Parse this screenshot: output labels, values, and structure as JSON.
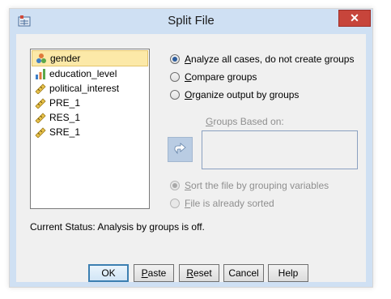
{
  "window": {
    "title": "Split File"
  },
  "variables": [
    {
      "name": "gender",
      "icon": "nominal-variable-icon",
      "selected": true
    },
    {
      "name": "education_level",
      "icon": "ordinal-variable-icon",
      "selected": false
    },
    {
      "name": "political_interest",
      "icon": "scale-variable-icon",
      "selected": false
    },
    {
      "name": "PRE_1",
      "icon": "scale-variable-icon",
      "selected": false
    },
    {
      "name": "RES_1",
      "icon": "scale-variable-icon",
      "selected": false
    },
    {
      "name": "SRE_1",
      "icon": "scale-variable-icon",
      "selected": false
    }
  ],
  "mode_options": [
    {
      "first": "A",
      "rest": "nalyze all cases, do not create groups",
      "checked": true
    },
    {
      "first": "C",
      "rest": "ompare groups",
      "checked": false
    },
    {
      "first": "O",
      "rest": "rganize output by groups",
      "checked": false
    }
  ],
  "groups_based_on": {
    "label_first": "G",
    "label_rest": "roups Based on:"
  },
  "sort_options": [
    {
      "first": "S",
      "rest": "ort the file by grouping variables",
      "checked": true,
      "disabled": true
    },
    {
      "first": "F",
      "rest": "ile is already sorted",
      "checked": false,
      "disabled": true
    }
  ],
  "status": "Current Status: Analysis by groups is off.",
  "buttons": {
    "ok": "OK",
    "paste_first": "P",
    "paste_rest": "aste",
    "reset_first": "R",
    "reset_rest": "eset",
    "cancel": "Cancel",
    "help": "Help"
  },
  "close_glyph": "✕",
  "colors": {
    "accent": "#3c7fb1",
    "close": "#c7453b",
    "selection": "#fce9a8",
    "frame": "#cfe0f3"
  }
}
